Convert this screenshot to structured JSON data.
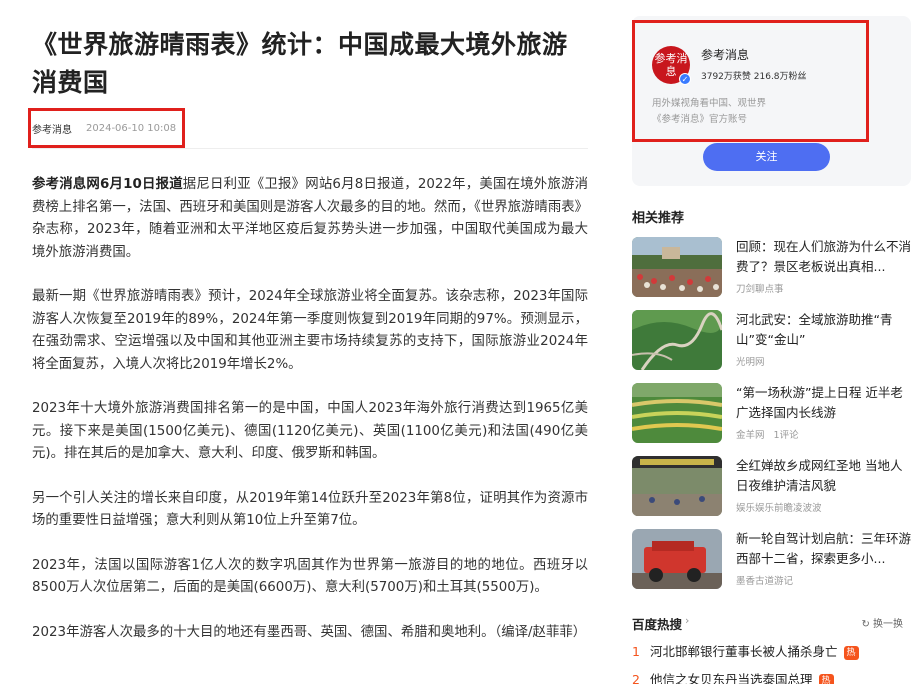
{
  "article": {
    "title": "《世界旅游晴雨表》统计：中国成最大境外旅游消费国",
    "source": "参考消息",
    "time": "2024-06-10 10:08",
    "lead": "参考消息网6月10日报道",
    "paragraphs": [
      "据尼日利亚《卫报》网站6月8日报道，2022年，美国在境外旅游消费榜上排名第一，法国、西班牙和美国则是游客人次最多的目的地。然而，《世界旅游晴雨表》杂志称，2023年，随着亚洲和太平洋地区疫后复苏势头进一步加强，中国取代美国成为最大境外旅游消费国。",
      "最新一期《世界旅游晴雨表》预计，2024年全球旅游业将全面复苏。该杂志称，2023年国际游客人次恢复至2019年的89%，2024年第一季度则恢复到2019年同期的97%。预测显示，在强劲需求、空运增强以及中国和其他亚洲主要市场持续复苏的支持下，国际旅游业2024年将全面复苏，入境人次将比2019年增长2%。",
      "2023年十大境外旅游消费国排名第一的是中国，中国人2023年海外旅行消费达到1965亿美元。接下来是美国(1500亿美元)、德国(1120亿美元)、英国(1100亿美元)和法国(490亿美元)。排在其后的是加拿大、意大利、印度、俄罗斯和韩国。",
      "另一个引人关注的增长来自印度，从2019年第14位跃升至2023年第8位，证明其作为资源市场的重要性日益增强；意大利则从第10位上升至第7位。",
      "2023年，法国以国际游客1亿人次的数字巩固其作为世界第一旅游目的地的地位。西班牙以8500万人次位居第二，后面的是美国(6600万)、意大利(5700万)和土耳其(5500万)。",
      "2023年游客人次最多的十大目的地还有墨西哥、英国、德国、希腊和奥地利。（编译/赵菲菲）"
    ]
  },
  "author": {
    "avatar_text": "参考消息",
    "name": "参考消息",
    "stats": "3792万获赞 216.8万粉丝",
    "desc_line1": "用外媒视角看中国、观世界",
    "desc_line2": "《参考消息》官方账号",
    "follow_label": "关注"
  },
  "related": {
    "title": "相关推荐",
    "items": [
      {
        "text": "回顾：现在人们旅游为什么不消费了？景区老板说出真相...",
        "source": "刀剑聊点事",
        "comments": ""
      },
      {
        "text": "河北武安：全域旅游助推“青山”变“金山”",
        "source": "光明网",
        "comments": ""
      },
      {
        "text": "“第一场秋游”提上日程 近半老广选择国内长线游",
        "source": "金羊网",
        "comments": "1评论"
      },
      {
        "text": "全红婵故乡成网红圣地 当地人日夜维护清洁风貌",
        "source": "娱乐娱乐前瞻凌波波",
        "comments": ""
      },
      {
        "text": "新一轮自驾计划启航：三年环游西部十二省，探索更多小...",
        "source": "墨香古道游记",
        "comments": ""
      }
    ]
  },
  "hot": {
    "title": "百度热搜",
    "refresh_label": "换一换",
    "items": [
      {
        "rank": "1",
        "text": "河北邯郸银行董事长被人捅杀身亡",
        "tag": "热"
      },
      {
        "rank": "2",
        "text": "他信之女贝东丹当选泰国总理",
        "tag": "热"
      }
    ]
  },
  "colors": {
    "accent": "#4e6ef2",
    "highlight_box": "#e0201c",
    "hot_rank": "#f5541d"
  }
}
